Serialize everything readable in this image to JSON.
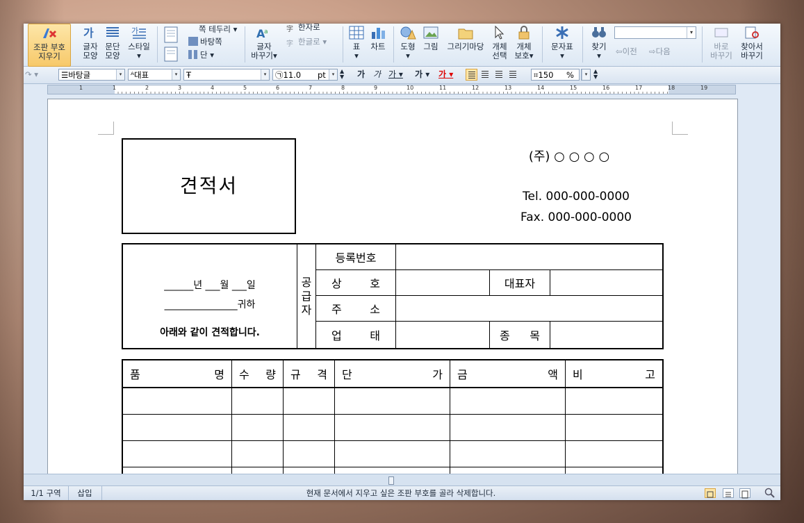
{
  "ribbon": {
    "clear_format_label_1": "조판 부호",
    "clear_format_label_2": "지우기",
    "char_shape_1": "글자",
    "char_shape_2": "모양",
    "para_shape_1": "문단",
    "para_shape_2": "모양",
    "style": "스타일",
    "partial_label": "쪽 테두리",
    "background_label": "바탕쪽",
    "column_label": "단",
    "char_replace_1": "글자",
    "char_replace_2": "바꾸기",
    "hanja_label": "한자로",
    "hangul_label": "한글로",
    "table_label": "표",
    "chart_label": "차트",
    "shape_label": "도형",
    "picture_label": "그림",
    "drawing_label": "그리기마당",
    "obj_select_1": "개체",
    "obj_select_2": "선택",
    "obj_protect_1": "개체",
    "obj_protect_2": "보호",
    "symbol_label": "문자표",
    "find_label": "찾기",
    "prev_label": "이전",
    "next_label": "다음",
    "correct_1": "바로",
    "correct_2": "바꾸기",
    "find_replace_1": "찾아서",
    "find_replace_2": "바꾸기"
  },
  "format_bar": {
    "style_value": "바탕글",
    "lang_value": "대표",
    "font_value": "",
    "size_value": "11.0",
    "size_unit": "pt",
    "bold": "가",
    "italic": "가",
    "underline": "가",
    "strike": "가",
    "color": "가",
    "zoom_value": "150",
    "zoom_unit": "%"
  },
  "ruler": {
    "labels": [
      "1",
      "1",
      "2",
      "3",
      "4",
      "5",
      "6",
      "7",
      "8",
      "9",
      "10",
      "11",
      "12",
      "13",
      "14",
      "15",
      "16",
      "17",
      "18",
      "19"
    ]
  },
  "document": {
    "title": "견적서",
    "company": "(주) ○ ○ ○ ○",
    "tel": "Tel. 000-000-0000",
    "fax": "Fax. 000-000-0000",
    "date_line": "______년 ___월 ___일",
    "recipient_line": "_______________귀하",
    "statement": "아래와 같이 견적합니다.",
    "supplier_vertical": [
      "공",
      "급",
      "자"
    ],
    "reg_number": "등록번호",
    "trade_name": [
      "상",
      "호"
    ],
    "representative": "대표자",
    "address": [
      "주",
      "소"
    ],
    "business_type": [
      "업",
      "태"
    ],
    "business_item": [
      "종",
      "목"
    ],
    "items_header": [
      [
        "품",
        "명"
      ],
      [
        "수",
        "량"
      ],
      [
        "규",
        "격"
      ],
      [
        "단",
        "가"
      ],
      [
        "금",
        "액"
      ],
      [
        "비",
        "고"
      ]
    ]
  },
  "status": {
    "section": "1/1 구역",
    "mode": "삽입",
    "message": "현재 문서에서 지우고 싶은 조판 부호를 골라 삭제합니다."
  }
}
